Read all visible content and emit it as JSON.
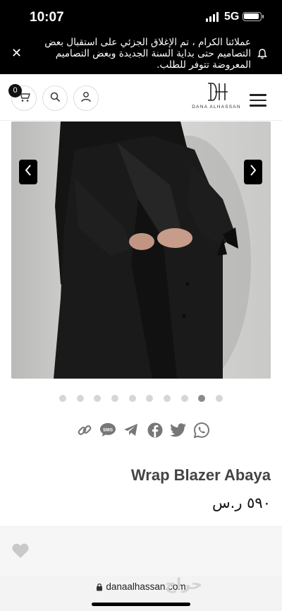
{
  "status_bar": {
    "time": "10:07",
    "network": "5G"
  },
  "announcement": {
    "message": "عملائنا الكرام ، تم الإغلاق الجزئي على استقبال بعض التصاميم حتى بداية السنة الجديدة وبعض التصاميم المعروضة تتوفر للطلب.",
    "close_icon": "close-icon",
    "bell_icon": "bell-icon"
  },
  "header": {
    "cart_count": "0",
    "logo_text": "DANA ALHASSAN",
    "icons": [
      "cart-icon",
      "search-icon",
      "user-icon",
      "hamburger-menu-icon"
    ]
  },
  "gallery": {
    "slide_count": 10,
    "active_index": 8,
    "prev_icon": "chevron-left-icon",
    "next_icon": "chevron-right-icon"
  },
  "share": {
    "icons": [
      "link-icon",
      "sms-icon",
      "telegram-icon",
      "facebook-icon",
      "twitter-icon",
      "whatsapp-icon"
    ],
    "sms_label": "SMS"
  },
  "product": {
    "title": "Wrap Blazer Abaya",
    "price": "٥٩٠ ر.س"
  },
  "browser": {
    "url": "danaalhassan.com",
    "watermark": "حراج"
  },
  "colors": {
    "accent": "#000000",
    "dot_inactive": "#d6d6d6",
    "dot_active": "#8a8a8a"
  }
}
